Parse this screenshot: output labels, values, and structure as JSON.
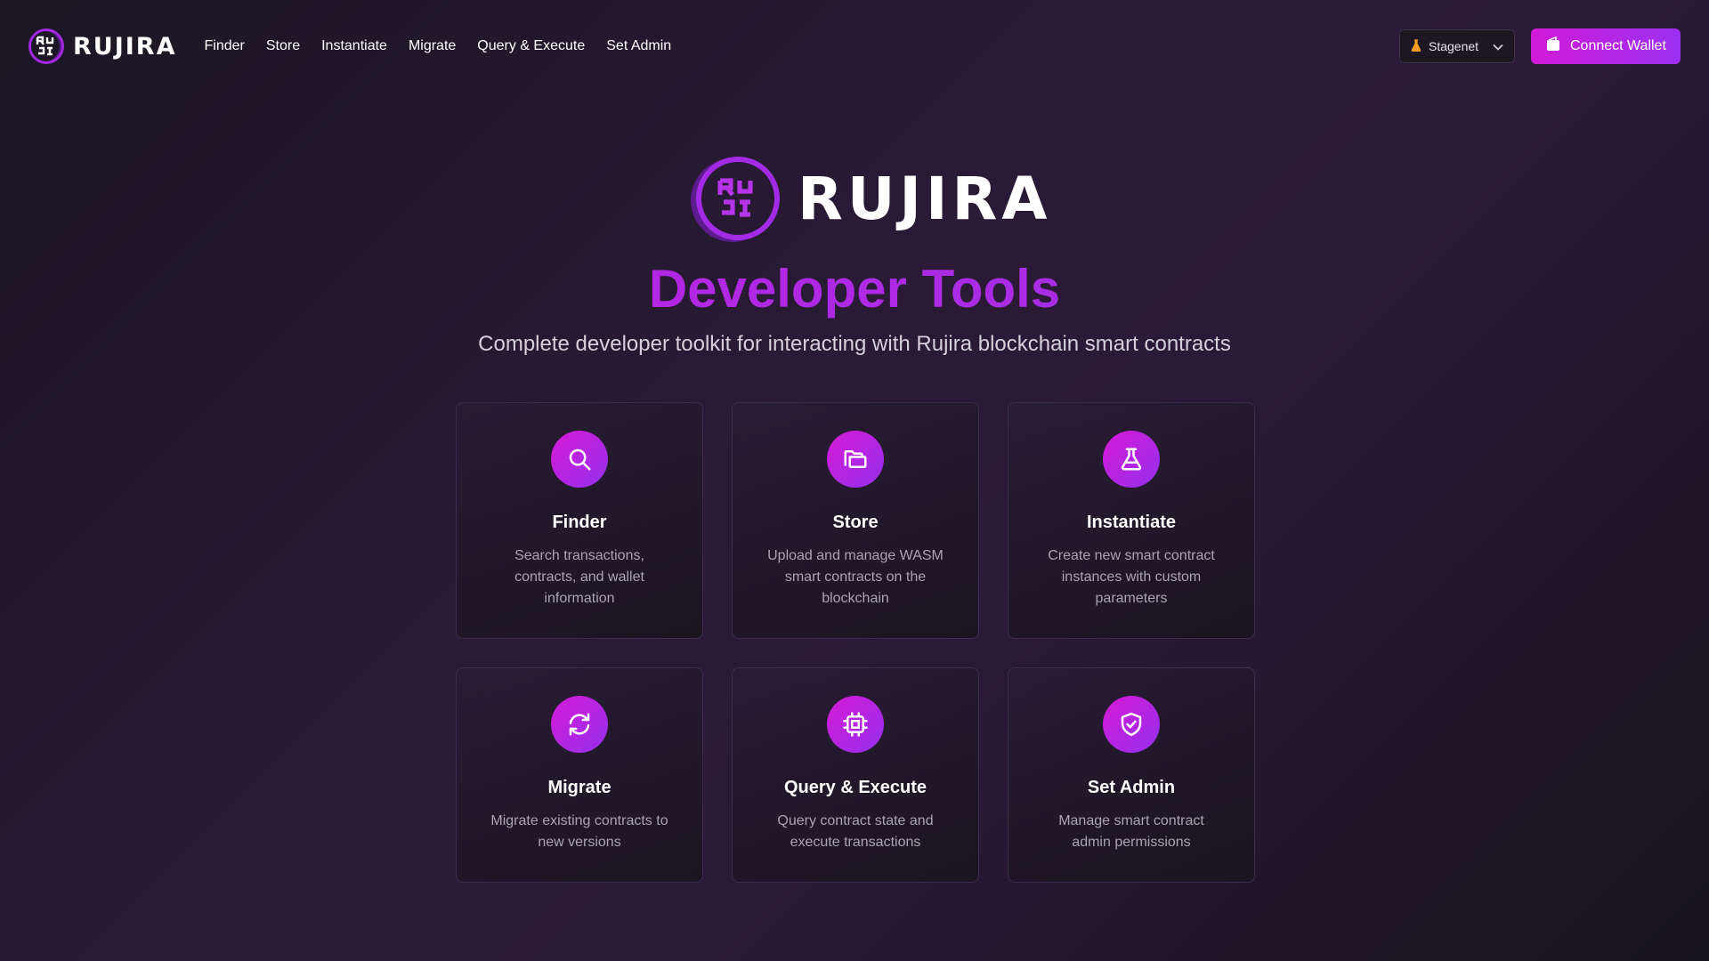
{
  "header": {
    "brand": "RUJIRA",
    "nav": [
      "Finder",
      "Store",
      "Instantiate",
      "Migrate",
      "Query & Execute",
      "Set Admin"
    ],
    "network": {
      "selected": "Stagenet",
      "icon": "flask-icon"
    },
    "connect_label": "Connect Wallet",
    "connect_icon": "wallet-icon"
  },
  "hero": {
    "brand": "RUJIRA",
    "title": "Developer Tools",
    "subtitle": "Complete developer toolkit for interacting with Rujira blockchain smart contracts"
  },
  "cards": [
    {
      "title": "Finder",
      "description": "Search transactions, contracts, and wallet information",
      "icon": "search-icon"
    },
    {
      "title": "Store",
      "description": "Upload and manage WASM smart contracts on the blockchain",
      "icon": "folder-open-icon"
    },
    {
      "title": "Instantiate",
      "description": "Create new smart contract instances with custom parameters",
      "icon": "flask-icon"
    },
    {
      "title": "Migrate",
      "description": "Migrate existing contracts to new versions",
      "icon": "refresh-icon"
    },
    {
      "title": "Query & Execute",
      "description": "Query contract state and execute transactions",
      "icon": "cpu-icon"
    },
    {
      "title": "Set Admin",
      "description": "Manage smart contract admin permissions",
      "icon": "shield-check-icon"
    }
  ],
  "colors": {
    "accent": "#c21ee0",
    "accent_secondary": "#9a30f0",
    "background": "#221a2c"
  }
}
